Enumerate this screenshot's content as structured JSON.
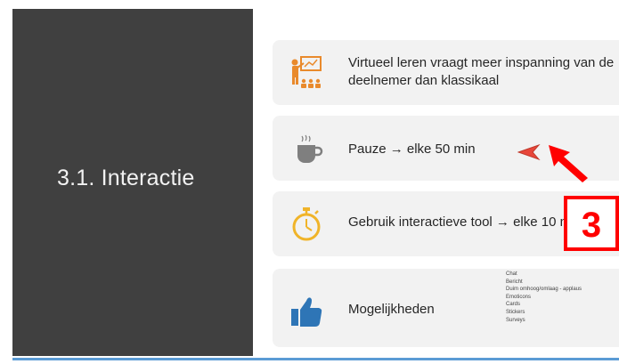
{
  "slide": {
    "title": "3.1. Interactie",
    "cards": [
      {
        "icon": "classroom-icon",
        "text": "Virtueel leren vraagt meer inspanning van de deelnemer dan klassikaal"
      },
      {
        "icon": "coffee-cup-icon",
        "text": "Pauze → elke 50 min"
      },
      {
        "icon": "stopwatch-icon",
        "text": "Gebruik interactieve tool → elke 10 min"
      },
      {
        "icon": "thumbs-up-icon",
        "text": "Mogelijkheden",
        "options": [
          "Chat",
          "Bericht",
          "Duim omhoog/omlaag - applaus",
          "Emoticons",
          "Cards",
          "Stickers",
          "Surveys"
        ]
      }
    ]
  },
  "annotation": {
    "badge_number": "3",
    "color": "#ff0000"
  },
  "colors": {
    "panel": "#404040",
    "card": "#f2f2f2",
    "icon_orange": "#e98a2c",
    "icon_blue": "#2e75b6",
    "icon_gray": "#7f7f7f",
    "accent_line": "#5b9bd5"
  }
}
